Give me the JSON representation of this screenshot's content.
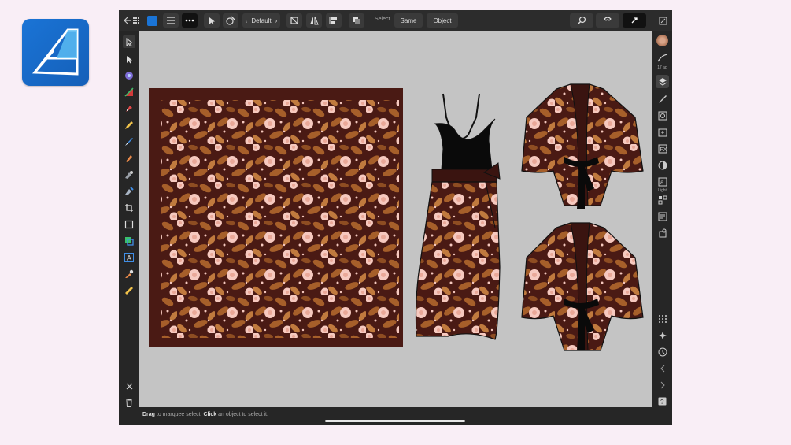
{
  "app": {
    "name": "Affinity Designer"
  },
  "toolbar": {
    "preset_label": "Default",
    "select_label": "Select",
    "same_label": "Same",
    "object_label": "Object"
  },
  "right_panel": {
    "brush_size": "17 ap",
    "text_style_label": "Light"
  },
  "status": {
    "action1": "Drag",
    "text1": " to marquee select. ",
    "action2": "Click",
    "text2": " an object to select it."
  },
  "colors": {
    "pattern_background": "#4a1a14",
    "pattern_leaf": "#a65f2a",
    "pattern_flower": "#f6c9bf",
    "canvas": "#c4c4c4",
    "ui_dark": "#242424",
    "brand_blue": "#1a74d6"
  },
  "icons": [
    "app-logo-icon",
    "back-icon",
    "grid-icon",
    "app-icon",
    "hamburger-icon",
    "more-icon",
    "move-tool-icon",
    "node-tool-icon",
    "chevron-left-icon",
    "chevron-right-icon",
    "transform-icon",
    "flip-icon",
    "align-icon",
    "boolean-icon",
    "zoom-icon",
    "snapping-icon",
    "constraints-icon",
    "collapse-icon",
    "pointer-icon",
    "pen-icon",
    "pencil-icon",
    "brush-icon",
    "fill-icon",
    "crop-icon",
    "rectangle-icon",
    "text-icon",
    "eyedropper-icon",
    "measure-icon",
    "close-icon",
    "trash-icon",
    "layers-icon",
    "stroke-icon",
    "effects-icon",
    "navigator-icon",
    "history-icon",
    "help-icon"
  ]
}
